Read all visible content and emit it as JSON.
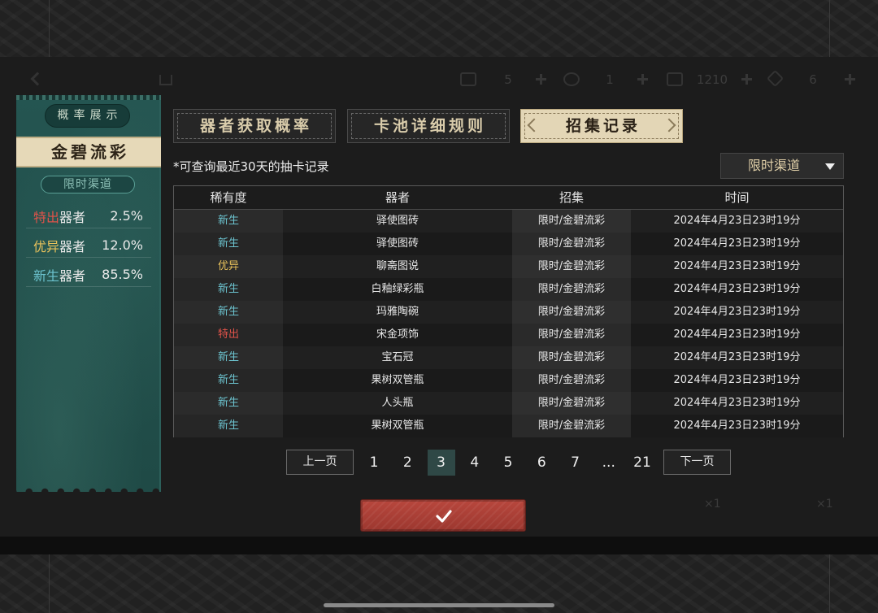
{
  "hud": {
    "values": [
      "5",
      "1",
      "1210",
      "6"
    ],
    "icons": [
      "ticket-icon",
      "swirl-icon",
      "scroll-icon",
      "gem-icon"
    ]
  },
  "bottom_faint": {
    "left_count": "×1",
    "right_count": "×1"
  },
  "left_panel": {
    "header": "概率展示",
    "banner": "金碧流彩",
    "channel": "限时渠道",
    "rates": [
      {
        "rarity": "特出",
        "suffix": "器者",
        "percent": "2.5%"
      },
      {
        "rarity": "优异",
        "suffix": "器者",
        "percent": "12.0%"
      },
      {
        "rarity": "新生",
        "suffix": "器者",
        "percent": "85.5%"
      }
    ]
  },
  "tabs": [
    {
      "label": "器者获取概率",
      "active": false
    },
    {
      "label": "卡池详细规则",
      "active": false
    },
    {
      "label": "招集记录",
      "active": true
    }
  ],
  "note": "*可查询最近30天的抽卡记录",
  "filter": {
    "selected": "限时渠道",
    "icon": "caret-down-icon"
  },
  "table": {
    "headers": [
      "稀有度",
      "器者",
      "招集",
      "时间"
    ],
    "rows": [
      {
        "rarity": "新生",
        "item": "驿使图砖",
        "recruit": "限时/金碧流彩",
        "time": "2024年4月23日23时19分"
      },
      {
        "rarity": "新生",
        "item": "驿使图砖",
        "recruit": "限时/金碧流彩",
        "time": "2024年4月23日23时19分"
      },
      {
        "rarity": "优异",
        "item": "聊斋图说",
        "recruit": "限时/金碧流彩",
        "time": "2024年4月23日23时19分"
      },
      {
        "rarity": "新生",
        "item": "白釉绿彩瓶",
        "recruit": "限时/金碧流彩",
        "time": "2024年4月23日23时19分"
      },
      {
        "rarity": "新生",
        "item": "玛雅陶碗",
        "recruit": "限时/金碧流彩",
        "time": "2024年4月23日23时19分"
      },
      {
        "rarity": "特出",
        "item": "宋金项饰",
        "recruit": "限时/金碧流彩",
        "time": "2024年4月23日23时19分"
      },
      {
        "rarity": "新生",
        "item": "宝石冠",
        "recruit": "限时/金碧流彩",
        "time": "2024年4月23日23时19分"
      },
      {
        "rarity": "新生",
        "item": "果树双管瓶",
        "recruit": "限时/金碧流彩",
        "time": "2024年4月23日23时19分"
      },
      {
        "rarity": "新生",
        "item": "人头瓶",
        "recruit": "限时/金碧流彩",
        "time": "2024年4月23日23时19分"
      },
      {
        "rarity": "新生",
        "item": "果树双管瓶",
        "recruit": "限时/金碧流彩",
        "time": "2024年4月23日23时19分"
      }
    ]
  },
  "pagination": {
    "prev": "上一页",
    "next": "下一页",
    "pages": [
      "1",
      "2",
      "3",
      "4",
      "5",
      "6",
      "7",
      "...",
      "21"
    ],
    "current": "3"
  },
  "confirm": {
    "icon": "checkmark-icon"
  },
  "colors": {
    "rarity": {
      "新生": "#6cc3cf",
      "优异": "#e9c25b",
      "特出": "#e0534a"
    },
    "panel_teal": "#21504b",
    "active_tab": "#e3d6b6",
    "confirm_red": "#ad3f36",
    "active_page": "#2f4846"
  }
}
